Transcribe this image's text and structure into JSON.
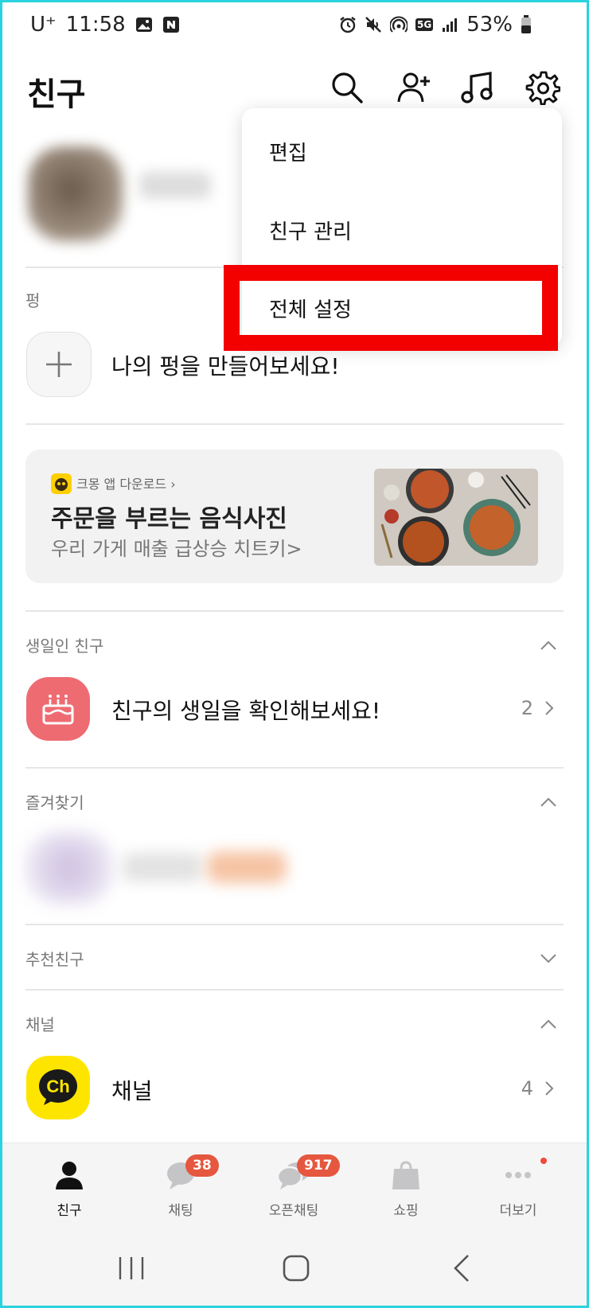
{
  "status_bar": {
    "carrier": "U⁺",
    "time": "11:58",
    "network": "5G",
    "battery": "53%"
  },
  "header": {
    "title": "친구"
  },
  "pyeong": {
    "label": "펑",
    "prompt": "나의 펑을 만들어보세요!"
  },
  "banner": {
    "source": "크몽 앱 다운로드 ›",
    "headline": "주문을 부르는 음식사진",
    "subtitle": "우리 가게 매출 급상승 치트키>"
  },
  "birthday": {
    "label": "생일인 친구",
    "text": "친구의 생일을 확인해보세요!",
    "count": "2"
  },
  "favorites": {
    "label": "즐겨찾기"
  },
  "recommended": {
    "label": "추천친구"
  },
  "channel": {
    "label": "채널",
    "text": "채널",
    "icon_text": "Ch",
    "count": "4"
  },
  "tabs": [
    {
      "label": "친구",
      "badge": ""
    },
    {
      "label": "채팅",
      "badge": "38"
    },
    {
      "label": "오픈채팅",
      "badge": "917"
    },
    {
      "label": "쇼핑",
      "badge": ""
    },
    {
      "label": "더보기",
      "badge": ""
    }
  ],
  "menu": {
    "items": [
      "편집",
      "친구 관리",
      "전체 설정"
    ]
  },
  "colors": {
    "highlight": "#f30000",
    "badge": "#e5573f",
    "birthday": "#ee6b72",
    "channel": "#fee500"
  }
}
